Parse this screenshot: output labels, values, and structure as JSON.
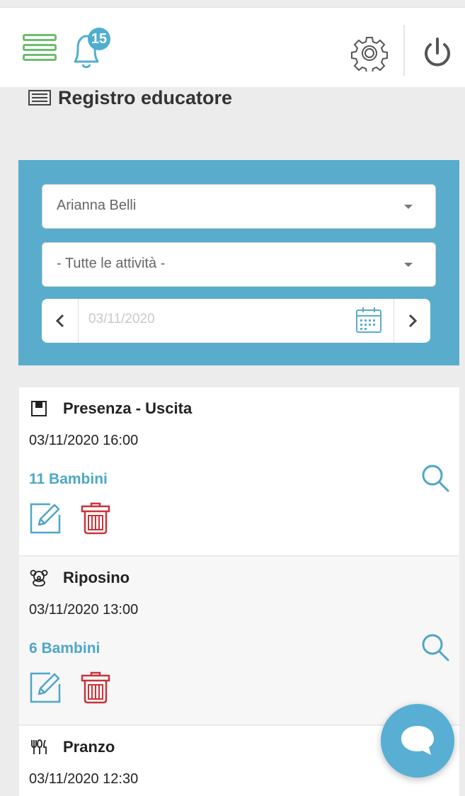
{
  "header": {
    "notifications_count": "15",
    "icons": {
      "menu": "hamburger-menu-icon",
      "bell": "bell-icon",
      "settings": "gear-icon",
      "logout": "power-icon"
    }
  },
  "page": {
    "title": "Registro educatore"
  },
  "filters": {
    "educator": {
      "selected": "Arianna Belli"
    },
    "activity": {
      "selected": "- Tutte le attività -"
    },
    "date": {
      "placeholder": "03/11/2020"
    }
  },
  "entries": [
    {
      "icon": "door-icon",
      "title": "Presenza - Uscita",
      "datetime": "03/11/2020 16:00",
      "count": "11 Bambini"
    },
    {
      "icon": "teddy-bear-icon",
      "title": "Riposino",
      "datetime": "03/11/2020 13:00",
      "count": "6 Bambini"
    },
    {
      "icon": "cutlery-icon",
      "title": "Pranzo",
      "datetime": "03/11/2020 12:30",
      "count": ""
    }
  ],
  "colors": {
    "accent": "#5aaccd",
    "link": "#4ea6c8",
    "delete": "#c9333a",
    "menu_green": "#6dbe70"
  }
}
